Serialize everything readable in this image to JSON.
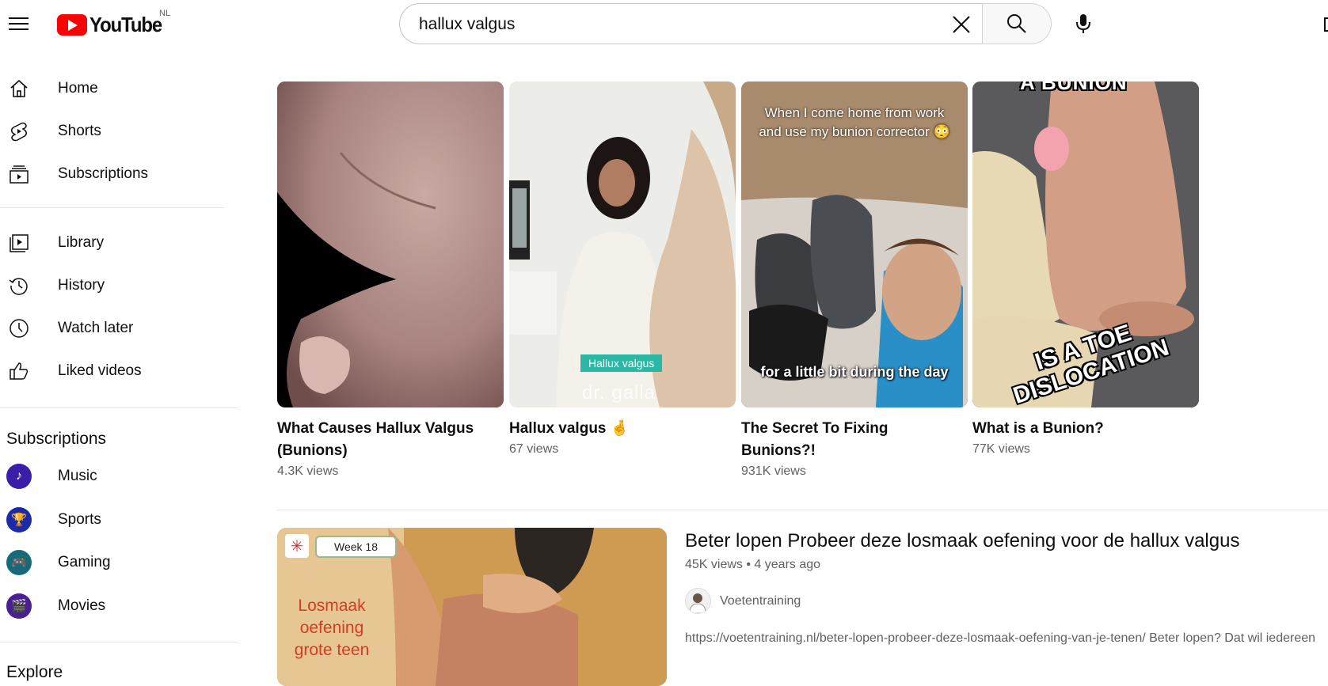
{
  "header": {
    "logo_text": "YouTube",
    "country_code": "NL",
    "search_value": "hallux valgus"
  },
  "sidebar": {
    "main_items": [
      {
        "label": "Home",
        "icon": "home-icon"
      },
      {
        "label": "Shorts",
        "icon": "shorts-icon"
      },
      {
        "label": "Subscriptions",
        "icon": "subscriptions-icon"
      }
    ],
    "library_items": [
      {
        "label": "Library",
        "icon": "library-icon"
      },
      {
        "label": "History",
        "icon": "history-icon"
      },
      {
        "label": "Watch later",
        "icon": "watch-later-icon"
      },
      {
        "label": "Liked videos",
        "icon": "liked-videos-icon"
      }
    ],
    "subscriptions_title": "Subscriptions",
    "subscriptions": [
      {
        "label": "Music",
        "color": "#3b1ea7"
      },
      {
        "label": "Sports",
        "color": "#1c2aa8"
      },
      {
        "label": "Gaming",
        "color": "#166b7a"
      },
      {
        "label": "Movies",
        "color": "#4a1e94"
      }
    ],
    "explore_title": "Explore"
  },
  "shorts": [
    {
      "title_line1": "What Causes Hallux Valgus",
      "title_line2": "(Bunions)",
      "views": "4.3K views"
    },
    {
      "title_line1": "Hallux valgus 🤞",
      "title_line2": "",
      "views": "67 views",
      "overlay_tag": "Hallux valgus",
      "overlay_brand": "dr. galla"
    },
    {
      "title_line1": "The Secret To Fixing",
      "title_line2": "Bunions?!",
      "views": "931K views",
      "overlay_top": "When I come home from work and use my bunion corrector 😳",
      "overlay_bottom": "for a little bit during the day"
    },
    {
      "title_line1": "What is a Bunion?",
      "title_line2": "",
      "views": "77K views",
      "overlay_top": "A BUNION",
      "overlay_bottom": "IS A TOE DISLOCATION"
    }
  ],
  "video": {
    "title": "Beter lopen Probeer deze losmaak oefening voor de hallux valgus",
    "views": "45K views",
    "age": "4 years ago",
    "channel": "Voetentraining",
    "description": "https://voetentraining.nl/beter-lopen-probeer-deze-losmaak-oefening-van-je-tenen/ Beter lopen? Dat wil iedereen",
    "thumb_badge": "Week 18",
    "thumb_text": "Losmaak oefening grote teen"
  }
}
